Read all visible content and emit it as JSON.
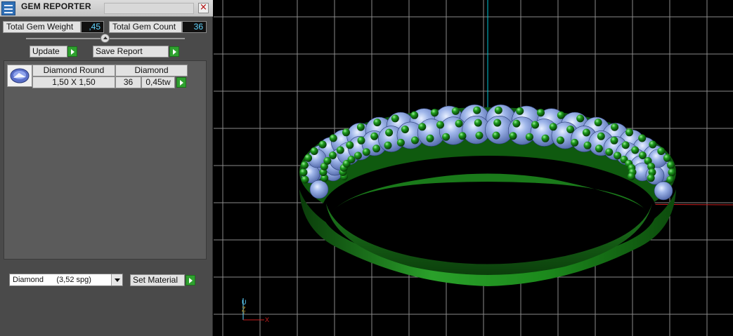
{
  "window": {
    "title": "GEM REPORTER",
    "close_label": "×"
  },
  "stats": {
    "weight_label": "Total Gem Weight",
    "weight_value": ",45",
    "count_label": "Total Gem Count",
    "count_value": "36"
  },
  "actions": {
    "update_label": "Update",
    "save_label": "Save Report"
  },
  "gem_table": {
    "header_name": "Diamond Round",
    "header_material": "Diamond",
    "size": "1,50 X 1,50",
    "count": "36",
    "weight": "0,45tw"
  },
  "material": {
    "selected": "Diamond      (3,52 spg)",
    "set_label": "Set Material"
  },
  "axes": {
    "z": "Z",
    "y": "U",
    "x": "X"
  },
  "colors": {
    "panel_bg": "#4a4a4a",
    "value_text": "#5fd4ff",
    "go_green": "#2fa12f",
    "ring_green": "#1f8a1f",
    "gem_blue": "#8aa6e0",
    "grid": "#8a8a8a",
    "axis_cyan": "#00c8d8",
    "axis_red": "#c81e1e"
  },
  "icons": {
    "app": "gem-reporter-icon",
    "close": "close-icon",
    "run": "play-arrow-icon",
    "dropdown": "chevron-down-icon"
  }
}
